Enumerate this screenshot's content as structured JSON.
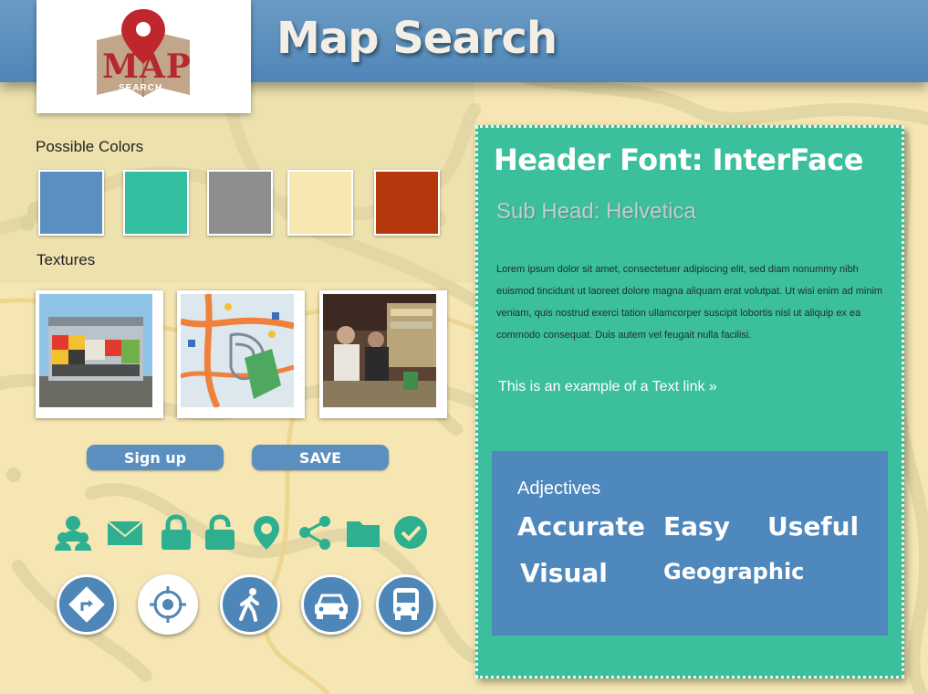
{
  "app": {
    "title": "Map Search",
    "logo_word": "MAP",
    "logo_sub": "SEARCH"
  },
  "colors_section": {
    "label": "Possible Colors",
    "swatches": [
      "#5b8fc1",
      "#33bea0",
      "#8f8e8e",
      "#f7e7b0",
      "#b5380c"
    ]
  },
  "textures_section": {
    "label": "Textures",
    "items": [
      "shopping-mall-photo",
      "street-map-image",
      "store-interior-photo"
    ]
  },
  "buttons": {
    "signup_label": "Sign up",
    "save_label": "SAVE"
  },
  "icons_row": [
    "users-icon",
    "envelope-icon",
    "lock-icon",
    "unlock-icon",
    "map-pin-icon",
    "share-icon",
    "folder-icon",
    "check-circle-icon"
  ],
  "circle_icons": [
    "directions-icon",
    "locate-target-icon",
    "walking-icon",
    "car-icon",
    "bus-icon"
  ],
  "panel": {
    "header": "Header Font: InterFace",
    "subhead": "Sub Head: Helvetica",
    "body": "Lorem ipsum dolor sit amet, consectetuer adipiscing elit, sed diam nonummy nibh euismod tincidunt ut laoreet dolore magna aliquam erat volutpat. Ut wisi enim ad minim veniam, quis nostrud exerci tation ullamcorper suscipit lobortis nisl ut aliquip ex ea commodo consequat. Duis autem vel feugait nulla facilisi.",
    "link_text": "This is an example of a Text link »"
  },
  "adjectives": {
    "title": "Adjectives",
    "words": [
      "Accurate",
      "Easy",
      "Useful",
      "Visual",
      "Geographic"
    ]
  },
  "accent_colors": {
    "blue": "#4f86b8",
    "teal": "#3bbf9c",
    "map_background": "#f5e6b4"
  }
}
